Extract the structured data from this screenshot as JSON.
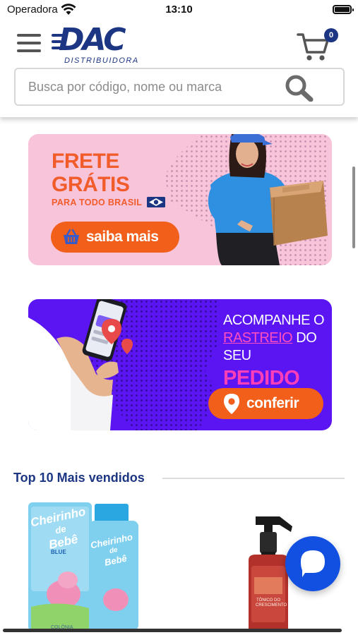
{
  "status_bar": {
    "carrier": "Operadora",
    "time": "13:10"
  },
  "header": {
    "logo_text": "DAC",
    "logo_subtitle": "DISTRIBUIDORA",
    "cart_count": "0",
    "search_placeholder": "Busca por código, nome ou marca"
  },
  "banners": {
    "frete": {
      "title_line1": "FRETE",
      "title_line2": "GRÁTIS",
      "subtitle": "PARA TODO BRASIL",
      "button_label": "saiba mais"
    },
    "rastreio": {
      "line1": "ACOMPANHE O",
      "line2_highlight": "RASTREIO",
      "line2_rest": " DO",
      "line3": "SEU",
      "line4": "PEDIDO",
      "button_label": "conferir"
    }
  },
  "section": {
    "title": "Top 10 Mais vendidos"
  },
  "products": [
    {
      "brand_line1": "Cheirinho",
      "brand_line2": "de",
      "brand_line3": "Bebê",
      "variant": "BLUE",
      "type": "COLÔNIA"
    },
    {
      "label": "TÔNICO DO CRESCIMENTO"
    }
  ],
  "colors": {
    "brand_blue": "#1d3684",
    "orange": "#f25f1a",
    "frete_bg": "#f7c4da",
    "rastreio_bg": "#5b14f2",
    "pink_accent": "#ff3fb8",
    "chat_blue": "#1150e0"
  }
}
